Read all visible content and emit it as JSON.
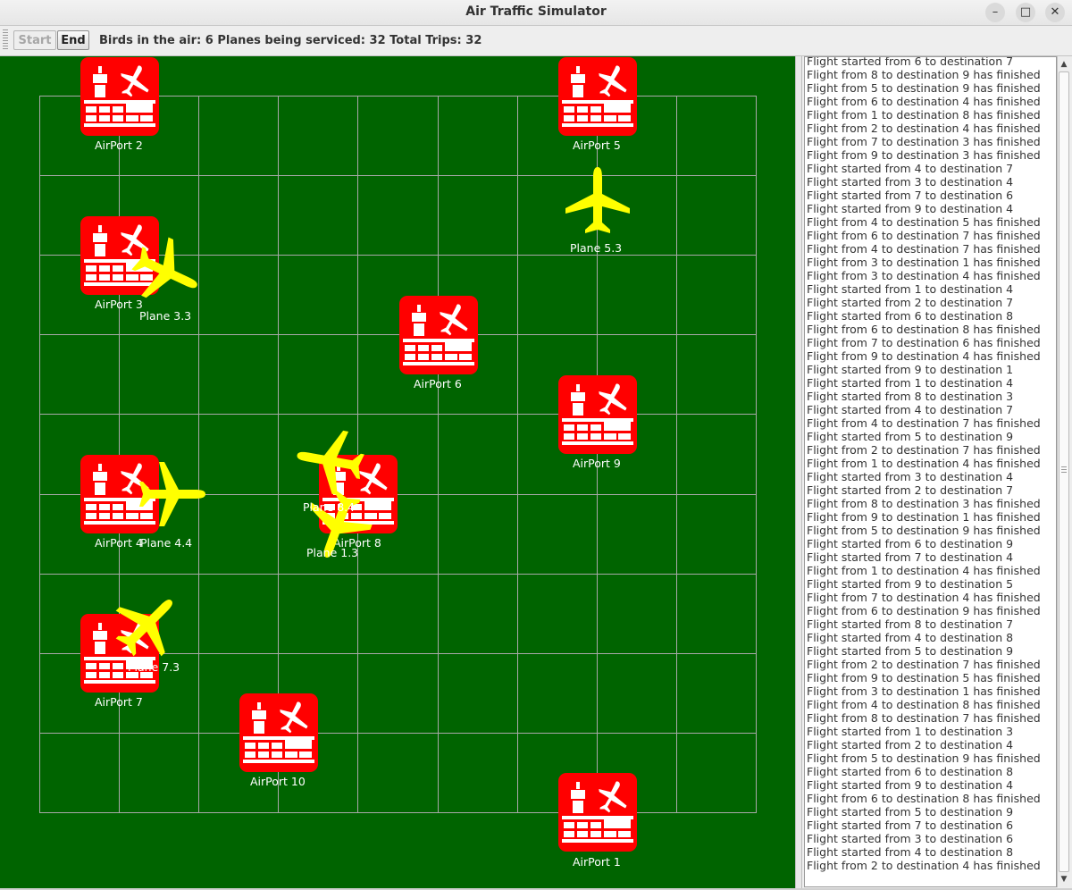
{
  "window": {
    "title": "Air Traffic Simulator"
  },
  "toolbar": {
    "start_label": "Start",
    "end_label": "End",
    "status_text": "Birds in the air: 6 Planes being serviced: 32 Total Trips: 32"
  },
  "map": {
    "background_color": "#006400",
    "grid_color": "#a9a9a9",
    "airport_color": "#ff0000",
    "plane_color": "#ffff00",
    "airports": [
      {
        "label": "AirPort 2"
      },
      {
        "label": "AirPort 5"
      },
      {
        "label": "AirPort 3"
      },
      {
        "label": "AirPort 6"
      },
      {
        "label": "AirPort 9"
      },
      {
        "label": "AirPort 4"
      },
      {
        "label": "AirPort 8"
      },
      {
        "label": "AirPort 7"
      },
      {
        "label": "AirPort 10"
      },
      {
        "label": "AirPort 1"
      }
    ],
    "planes": [
      {
        "label": "Plane 5.3"
      },
      {
        "label": "Plane 3.3"
      },
      {
        "label": "Plane 4.4"
      },
      {
        "label": "Plane 1.3"
      },
      {
        "label": "Plane 7.3"
      },
      {
        "label": "Plane 8.4"
      }
    ]
  },
  "log": {
    "lines": [
      "Flight started from 6 to destination 7",
      "Flight from 8 to destination 9 has finished",
      "Flight from 5 to destination 9 has finished",
      "Flight from 6 to destination 4 has finished",
      "Flight from 1 to destination 8 has finished",
      "Flight from 2 to destination 4 has finished",
      "Flight from 7 to destination 3 has finished",
      "Flight from 9 to destination 3 has finished",
      "Flight started from 4 to destination 7",
      "Flight started from 3 to destination 4",
      "Flight started from 7 to destination 6",
      "Flight started from 9 to destination 4",
      "Flight from 4 to destination 5 has finished",
      "Flight from 6 to destination 7 has finished",
      "Flight from 4 to destination 7 has finished",
      "Flight from 3 to destination 1 has finished",
      "Flight from 3 to destination 4 has finished",
      "Flight started from 1 to destination 4",
      "Flight started from 2 to destination 7",
      "Flight started from 6 to destination 8",
      "Flight from 6 to destination 8 has finished",
      "Flight from 7 to destination 6 has finished",
      "Flight from 9 to destination 4 has finished",
      "Flight started from 9 to destination 1",
      "Flight started from 1 to destination 4",
      "Flight started from 8 to destination 3",
      "Flight started from 4 to destination 7",
      "Flight from 4 to destination 7 has finished",
      "Flight started from 5 to destination 9",
      "Flight from 2 to destination 7 has finished",
      "Flight from 1 to destination 4 has finished",
      "Flight started from 3 to destination 4",
      "Flight started from 2 to destination 7",
      "Flight from 8 to destination 3 has finished",
      "Flight from 9 to destination 1 has finished",
      "Flight from 5 to destination 9 has finished",
      "Flight started from 6 to destination 9",
      "Flight started from 7 to destination 4",
      "Flight from 1 to destination 4 has finished",
      "Flight started from 9 to destination 5",
      "Flight from 7 to destination 4 has finished",
      "Flight from 6 to destination 9 has finished",
      "Flight started from 8 to destination 7",
      "Flight started from 4 to destination 8",
      "Flight started from 5 to destination 9",
      "Flight from 2 to destination 7 has finished",
      "Flight from 9 to destination 5 has finished",
      "Flight from 3 to destination 1 has finished",
      "Flight from 4 to destination 8 has finished",
      "Flight from 8 to destination 7 has finished",
      "Flight started from 1 to destination 3",
      "Flight started from 2 to destination 4",
      "Flight from 5 to destination 9 has finished",
      "Flight started from 6 to destination 8",
      "Flight started from 9 to destination 4",
      "Flight from 6 to destination 8 has finished",
      "Flight started from 5 to destination 9",
      "Flight started from 7 to destination 6",
      "Flight started from 3 to destination 6",
      "Flight started from 4 to destination 8",
      "Flight from 2 to destination 4 has finished"
    ]
  }
}
